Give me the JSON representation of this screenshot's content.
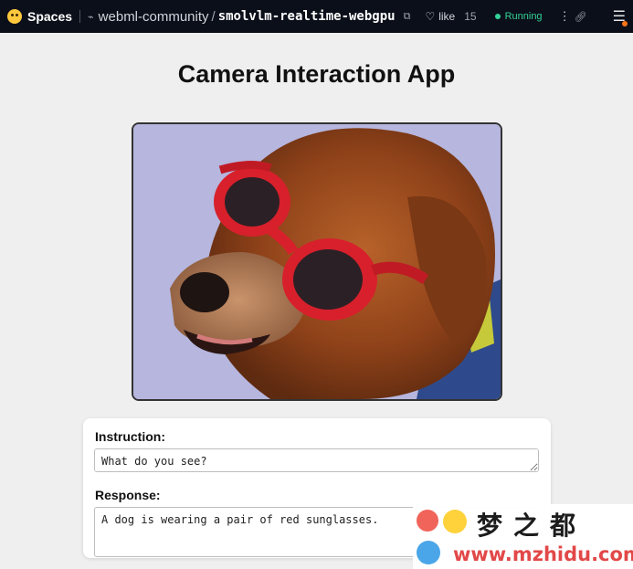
{
  "topbar": {
    "brand": "Spaces",
    "owner": "webml-community",
    "slash": "/",
    "repo": "smolvlm-realtime-webgpu",
    "like_label": "like",
    "like_count": "15",
    "status": "Running"
  },
  "icons": {
    "brand": "hugging-face-logo",
    "repo": "space-icon",
    "copy": "copy-icon",
    "like": "heart-icon",
    "status": "status-dot",
    "more": "more-vertical-icon",
    "link": "link-icon",
    "menu": "hamburger-menu-icon"
  },
  "app": {
    "title": "Camera Interaction App",
    "instruction_label": "Instruction:",
    "instruction_value": "What do you see?",
    "response_label": "Response:",
    "response_value": "A dog is wearing a pair of red sunglasses."
  },
  "watermark": {
    "text_cn": "梦之都",
    "url": "www.mzhidu.com"
  },
  "colors": {
    "topbar_bg": "#0b0f19",
    "page_bg": "#efefef",
    "running": "#34d399",
    "goggles": "#d7202b"
  }
}
